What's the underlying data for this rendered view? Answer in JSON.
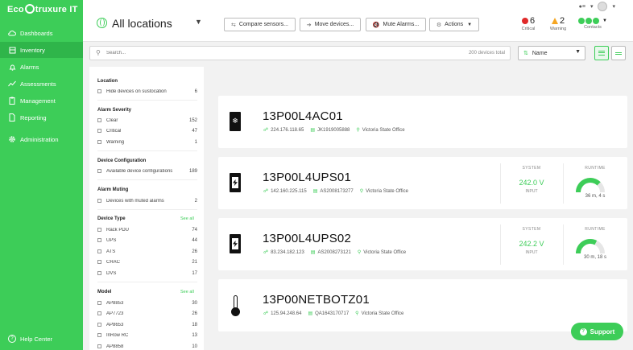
{
  "app": {
    "logo_left": "Eco",
    "logo_right": "truxure IT"
  },
  "sidebar": {
    "items": [
      {
        "label": "Dashboards",
        "icon": "cloud-icon"
      },
      {
        "label": "Inventory",
        "icon": "box-icon"
      },
      {
        "label": "Alarms",
        "icon": "bell-icon"
      },
      {
        "label": "Assessments",
        "icon": "chart-icon"
      },
      {
        "label": "Management",
        "icon": "clipboard-icon"
      },
      {
        "label": "Reporting",
        "icon": "document-icon"
      },
      {
        "label": "Administration",
        "icon": "gear-icon"
      }
    ],
    "help": "Help Center"
  },
  "header": {
    "title": "All locations",
    "buttons": {
      "compare": "Compare sensors...",
      "move": "Move devices...",
      "mute": "Mute Alarms...",
      "actions": "Actions"
    },
    "status": {
      "critical_count": "6",
      "critical_label": "Critical",
      "warning_count": "2",
      "warning_label": "Warning",
      "contacts_label": "Contacts"
    }
  },
  "search": {
    "placeholder": "Search...",
    "count": "200 devices total"
  },
  "sort": {
    "value": "Name"
  },
  "filters": {
    "location": {
      "title": "Location",
      "rows": [
        {
          "label": "Hide devices on sustocation",
          "count": "6"
        }
      ]
    },
    "alarm_severity": {
      "title": "Alarm Severity",
      "rows": [
        {
          "label": "Clear",
          "count": "152"
        },
        {
          "label": "Critical",
          "count": "47"
        },
        {
          "label": "Warning",
          "count": "1"
        }
      ]
    },
    "device_config": {
      "title": "Device Configuration",
      "rows": [
        {
          "label": "Available device configurations",
          "count": "189"
        }
      ]
    },
    "alarm_muting": {
      "title": "Alarm Muting",
      "rows": [
        {
          "label": "Devices with muted alarms",
          "count": "2"
        }
      ]
    },
    "device_type": {
      "title": "Device Type",
      "link": "See all",
      "rows": [
        {
          "label": "Rack PDU",
          "count": "74"
        },
        {
          "label": "UPS",
          "count": "44"
        },
        {
          "label": "ATS",
          "count": "26"
        },
        {
          "label": "CRAC",
          "count": "21"
        },
        {
          "label": "DVS",
          "count": "17"
        }
      ]
    },
    "model": {
      "title": "Model",
      "link": "See all",
      "rows": [
        {
          "label": "AP8853",
          "count": "30"
        },
        {
          "label": "AP7723",
          "count": "26"
        },
        {
          "label": "AP8653",
          "count": "18"
        },
        {
          "label": "InRow RC",
          "count": "13"
        },
        {
          "label": "AP8858",
          "count": "10"
        }
      ]
    }
  },
  "devices": [
    {
      "name": "13P00L4AC01",
      "ip": "224.176.118.65",
      "serial": "JK1919005888",
      "location": "Victoria State Office",
      "icon": "cooling-unit-icon"
    },
    {
      "name": "13P00L4UPS01",
      "ip": "142.160.225.115",
      "serial": "AS2008173277",
      "location": "Victoria State Office",
      "icon": "ups-icon",
      "system_label": "SYSTEM",
      "system_value": "242.0 V",
      "system_sub": "INPUT",
      "runtime_label": "RUNTIME",
      "runtime_value": "36 m, 4 s",
      "runtime_fraction": 0.75
    },
    {
      "name": "13P00L4UPS02",
      "ip": "83.234.182.123",
      "serial": "AS2008273121",
      "location": "Victoria State Office",
      "icon": "ups-icon",
      "system_label": "SYSTEM",
      "system_value": "242.2 V",
      "system_sub": "INPUT",
      "runtime_label": "RUNTIME",
      "runtime_value": "30 m, 18 s",
      "runtime_fraction": 0.65
    },
    {
      "name": "13P00NETBOTZ01",
      "ip": "125.94.248.64",
      "serial": "QA1643170717",
      "location": "Victoria State Office",
      "icon": "thermometer-icon"
    }
  ],
  "support": {
    "label": "Support"
  },
  "colors": {
    "brand": "#3dcd58",
    "critical": "#e02a2a",
    "warning": "#f5a623"
  }
}
